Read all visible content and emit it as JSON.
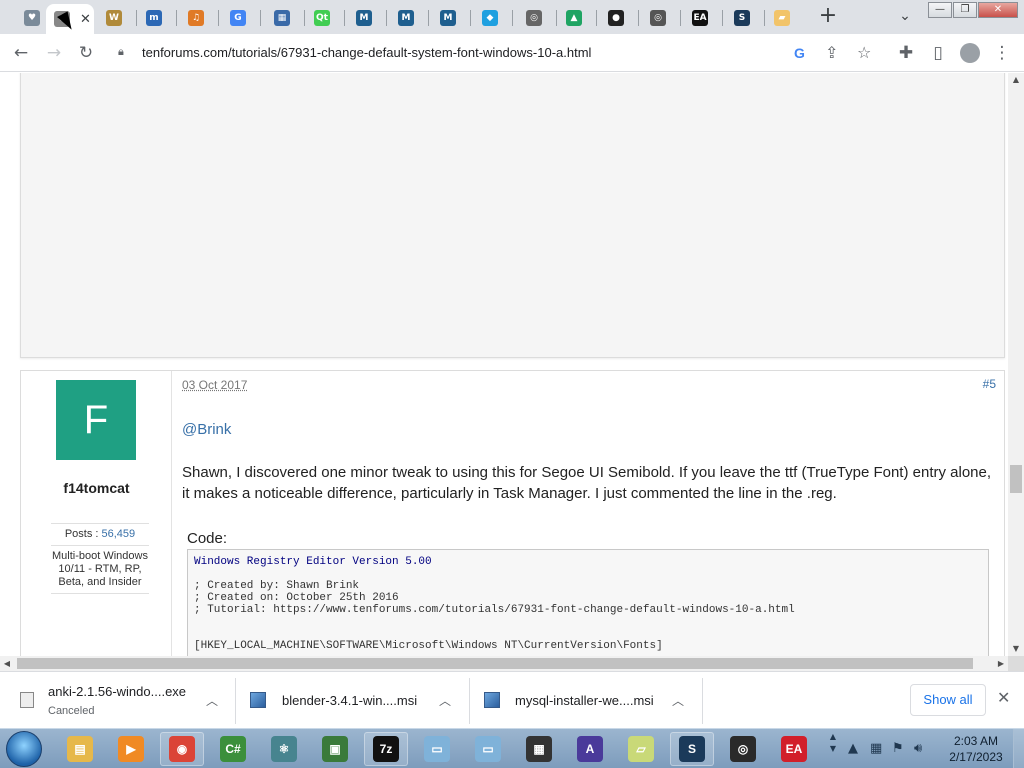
{
  "browser": {
    "tabs": [
      {
        "icon": "tenforums-icon",
        "color": "#7a8a99",
        "glyph": "♥"
      },
      {
        "icon": "tenforums-icon",
        "color": "#888",
        "glyph": "C",
        "active": true
      },
      {
        "icon": "wolf-icon",
        "color": "#b08a3a",
        "glyph": "W"
      },
      {
        "icon": "book-icon",
        "color": "#2c68b5",
        "glyph": "m"
      },
      {
        "icon": "headphones-icon",
        "color": "#e07a26",
        "glyph": "♫"
      },
      {
        "icon": "google-icon",
        "color": "#4285f4",
        "glyph": "G"
      },
      {
        "icon": "image-icon",
        "color": "#3a6aa8",
        "glyph": "▦"
      },
      {
        "icon": "qt-icon",
        "color": "#41cd52",
        "glyph": "Qt"
      },
      {
        "icon": "mysql-icon",
        "color": "#1f5f8f",
        "glyph": "M"
      },
      {
        "icon": "mysql-icon",
        "color": "#1f5f8f",
        "glyph": "M"
      },
      {
        "icon": "mysql-icon",
        "color": "#1f5f8f",
        "glyph": "M"
      },
      {
        "icon": "kodi-icon",
        "color": "#1fa0e0",
        "glyph": "◆"
      },
      {
        "icon": "globe-icon",
        "color": "#666",
        "glyph": "◎"
      },
      {
        "icon": "drive-icon",
        "color": "#1fa463",
        "glyph": "▲"
      },
      {
        "icon": "github-icon",
        "color": "#222",
        "glyph": "●"
      },
      {
        "icon": "globe-icon",
        "color": "#555",
        "glyph": "◎"
      },
      {
        "icon": "ea-icon",
        "color": "#111",
        "glyph": "EA"
      },
      {
        "icon": "steam-icon",
        "color": "#1b3a5a",
        "glyph": "S"
      },
      {
        "icon": "folder-icon",
        "color": "#f2c46a",
        "glyph": "▰"
      }
    ],
    "active_tab_close": "✕",
    "new_tab": "+",
    "tab_search": "⌄",
    "window_buttons": {
      "minimize": "—",
      "restore": "❐",
      "close": "✕"
    },
    "url": "tenforums.com/tutorials/67931-change-default-system-font-windows-10-a.html",
    "google_letter": "G"
  },
  "post": {
    "avatar_letter": "F",
    "username": "f14tomcat",
    "posts_label": "Posts :",
    "posts_value": "56,459",
    "rank": "Multi-boot Windows 10/11 - RTM, RP, Beta, and Insider",
    "date": "03 Oct 2017",
    "number": "#5",
    "mention": "@Brink",
    "text": "Shawn, I discovered one minor tweak to using this for Segoe UI Semibold. If you leave the ttf (TrueType Font) entry alone, it makes a noticeable difference, particularly in Task Manager. I just commented the line in the .reg.",
    "code_label": "Code:",
    "code_lines": [
      "Windows Registry Editor Version 5.00",
      "",
      "; Created by: Shawn Brink",
      "; Created on: October 25th 2016",
      "; Tutorial: https://www.tenforums.com/tutorials/67931-font-change-default-windows-10-a.html",
      "",
      "",
      "[HKEY_LOCAL_MACHINE\\SOFTWARE\\Microsoft\\Windows NT\\CurrentVersion\\Fonts]"
    ]
  },
  "downloads": {
    "items": [
      {
        "name": "anki-2.1.56-windo....exe",
        "status": "Canceled"
      },
      {
        "name": "blender-3.4.1-win....msi",
        "status": ""
      },
      {
        "name": "mysql-installer-we....msi",
        "status": ""
      }
    ],
    "show_all": "Show all",
    "close": "✕"
  },
  "taskbar": {
    "apps": [
      {
        "name": "explorer",
        "color": "#e6b84a",
        "label": "▤"
      },
      {
        "name": "media-player",
        "color": "#f08a24",
        "label": "▶"
      },
      {
        "name": "chrome",
        "color": "#db4437",
        "label": "◉"
      },
      {
        "name": "csharp",
        "color": "#3b8f3b",
        "label": "C#"
      },
      {
        "name": "electron",
        "color": "#47848f",
        "label": "⚛"
      },
      {
        "name": "monitor",
        "color": "#3a7a3a",
        "label": "▣"
      },
      {
        "name": "7zip",
        "color": "#111",
        "label": "7z"
      },
      {
        "name": "notepad-1",
        "color": "#7fb2d9",
        "label": "▭"
      },
      {
        "name": "notepad-2",
        "color": "#7fb2d9",
        "label": "▭"
      },
      {
        "name": "chip",
        "color": "#333",
        "label": "▦"
      },
      {
        "name": "arc",
        "color": "#4a3a9a",
        "label": "A"
      },
      {
        "name": "sticky",
        "color": "#c9d978",
        "label": "▱"
      },
      {
        "name": "steam",
        "color": "#1b3a5a",
        "label": "S"
      },
      {
        "name": "ubisoft",
        "color": "#2a2a2a",
        "label": "◎"
      },
      {
        "name": "ea",
        "color": "#d21f2a",
        "label": "EA"
      }
    ],
    "time": "2:03 AM",
    "date": "2/17/2023"
  },
  "colors": {
    "accent_link": "#3870a8",
    "avatar_bg": "#1fa083",
    "chrome_tabstrip": "#dee1e6"
  }
}
